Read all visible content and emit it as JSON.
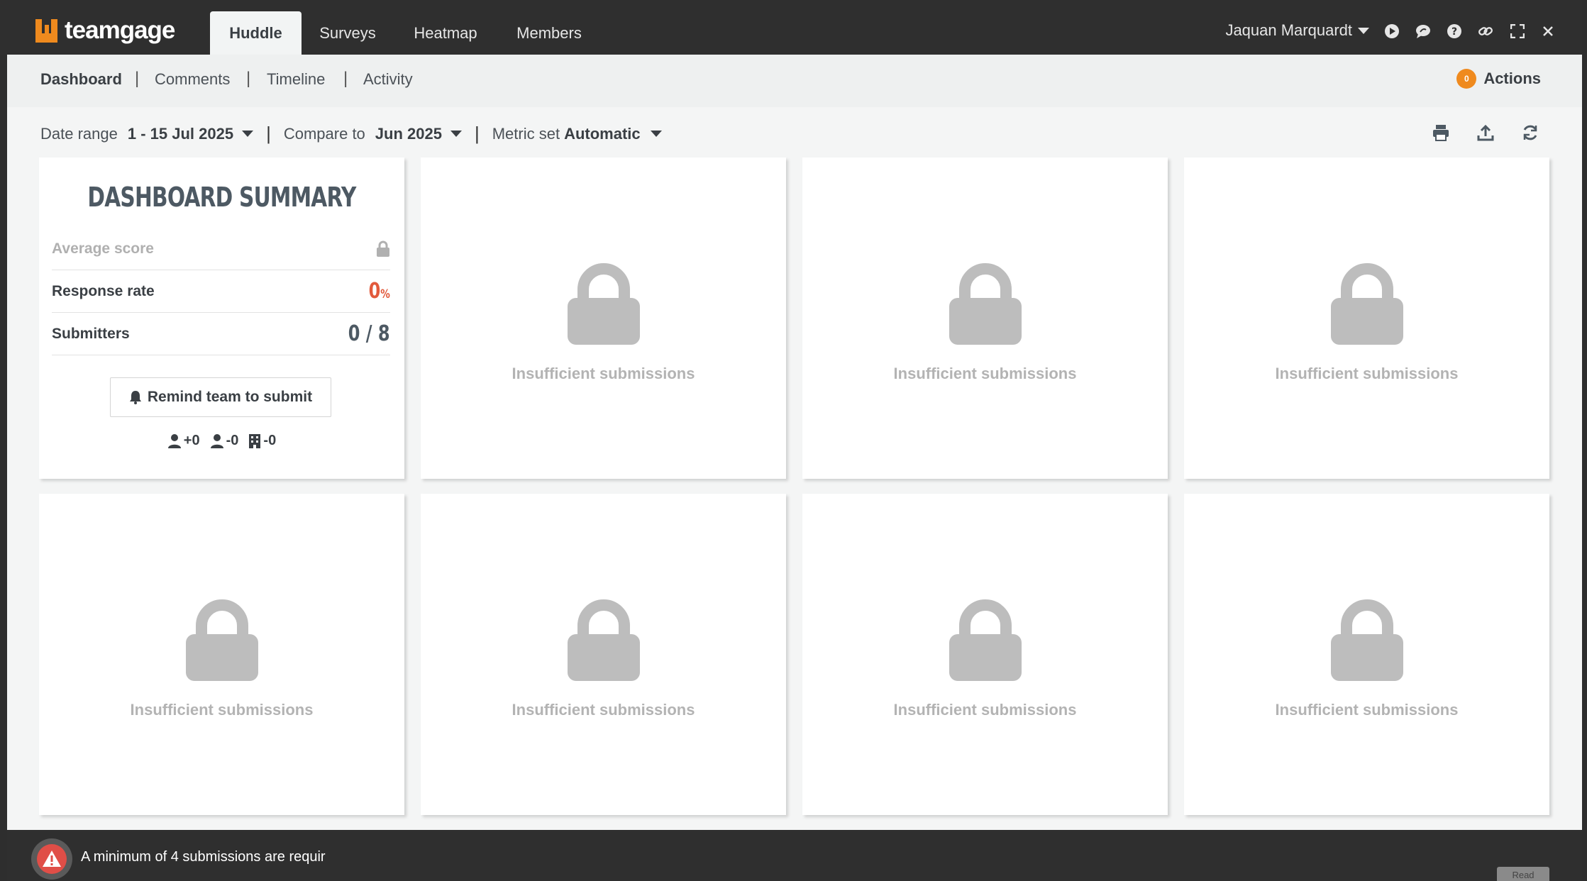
{
  "app": {
    "logo_text": "teamgage",
    "brand_color": "#ef8a1e"
  },
  "topnav": {
    "tabs": [
      {
        "label": "Huddle",
        "active": true
      },
      {
        "label": "Surveys",
        "active": false
      },
      {
        "label": "Heatmap",
        "active": false
      },
      {
        "label": "Members",
        "active": false
      }
    ],
    "user_name": "Jaquan Marquardt",
    "icons": [
      "play-icon",
      "chat-icon",
      "help-icon",
      "link-icon",
      "fullscreen-icon",
      "close-icon"
    ]
  },
  "subnav": {
    "items": [
      {
        "label": "Dashboard",
        "active": true
      },
      {
        "label": "Comments",
        "active": false
      },
      {
        "label": "Timeline",
        "active": false
      },
      {
        "label": "Activity",
        "active": false
      }
    ],
    "actions_label": "Actions",
    "actions_count": "0"
  },
  "filters": {
    "date_range_label": "Date range",
    "date_range_value": "1 - 15 Jul 2025",
    "compare_label": "Compare to",
    "compare_value": "Jun 2025",
    "metric_label": "Metric set",
    "metric_value": "Automatic",
    "tools": [
      "print-icon",
      "export-icon",
      "refresh-icon"
    ]
  },
  "summary": {
    "title": "DASHBOARD SUMMARY",
    "average_score_label": "Average score",
    "response_rate_label": "Response rate",
    "response_rate_value": "0",
    "response_rate_unit": "%",
    "submitters_label": "Submitters",
    "submitters_value": "0 / 8",
    "remind_button": "Remind team to submit",
    "joined": "+0",
    "left": "-0",
    "departments": "-0"
  },
  "locked_cards": {
    "message": "Insufficient submissions",
    "count": 7
  },
  "footer": {
    "message": "A minimum of 4 submissions are requir",
    "button_label": "Read"
  }
}
